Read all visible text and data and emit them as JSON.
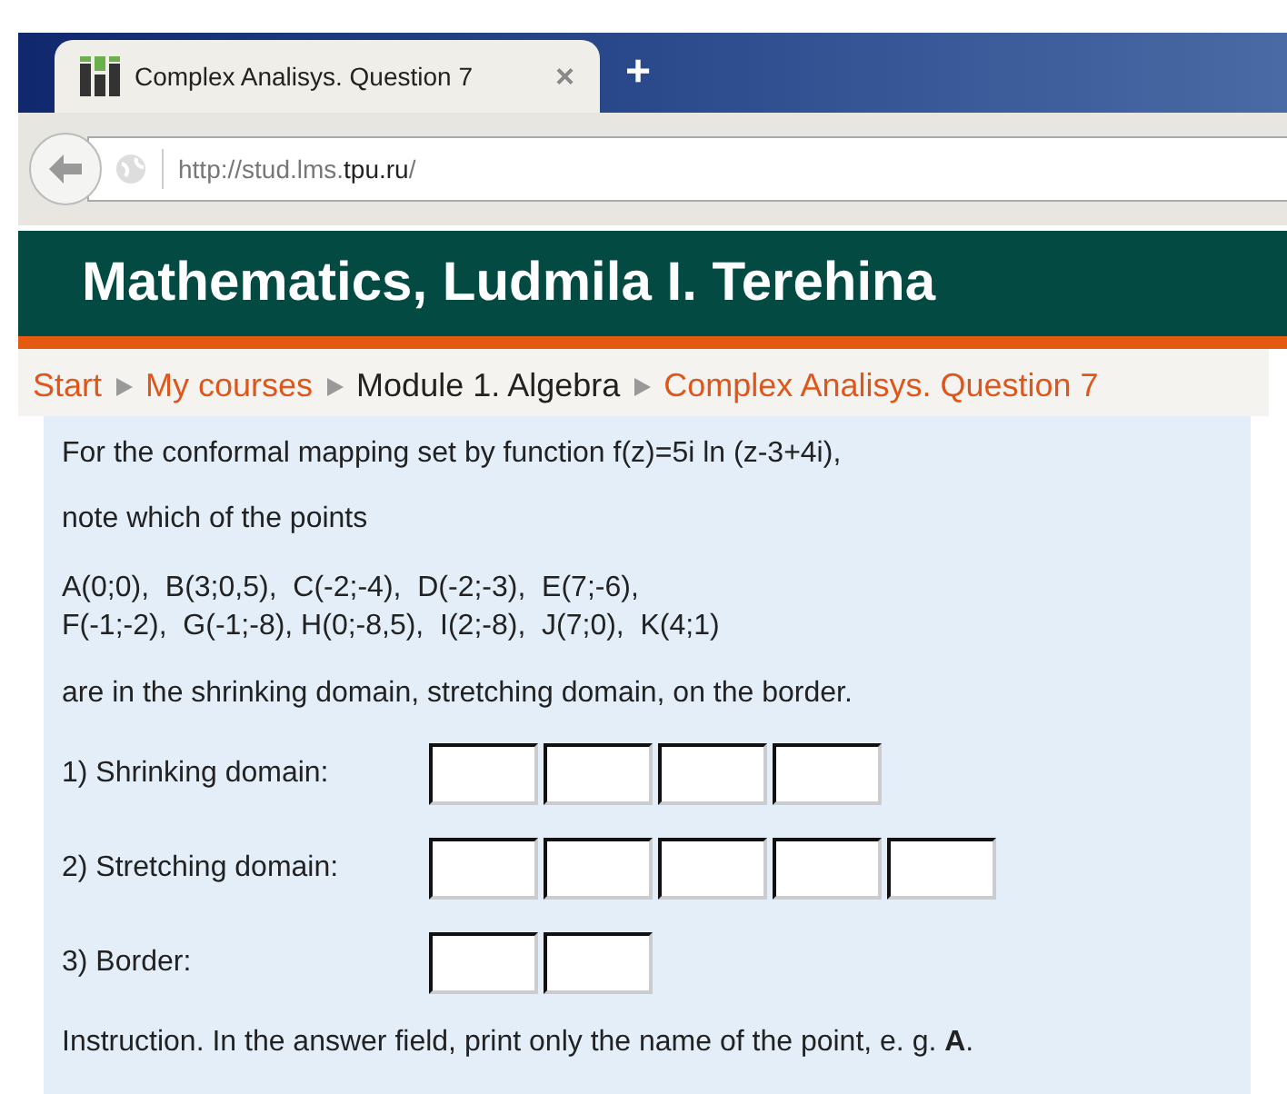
{
  "browser": {
    "tab_title": "Complex Analisys. Question 7",
    "tab_close": "×",
    "new_tab": "+",
    "url_prefix": "http://stud.lms.",
    "url_domain": "tpu.ru",
    "url_suffix": "/"
  },
  "header": {
    "title": "Mathematics, Ludmila I. Terehina"
  },
  "breadcrumb": [
    {
      "label": "Start",
      "kind": "link"
    },
    {
      "label": "My courses",
      "kind": "link"
    },
    {
      "label": "Module 1. Algebra",
      "kind": "current"
    },
    {
      "label": "Complex Analisys. Question 7",
      "kind": "link"
    }
  ],
  "question": {
    "paragraphs": [
      "For the conformal mapping set by function f(z)=5i ln (z-3+4i),",
      "note which of the points"
    ],
    "points": [
      "A(0;0),  B(3;0,5),  C(-2;-4),  D(-2;-3),  E(7;-6),",
      "F(-1;-2),  G(-1;-8), H(0;-8,5),  I(2;-8),  J(7;0),  K(4;1)"
    ],
    "task": "are in the shrinking domain, stretching domain, on the border.",
    "answers": [
      {
        "label": "1) Shrinking domain:",
        "fields": [
          {
            "kind": "text"
          },
          {
            "kind": "text"
          },
          {
            "kind": "text"
          },
          {
            "kind": "text"
          }
        ]
      },
      {
        "label": "2) Stretching domain:",
        "fields": [
          {
            "kind": "text"
          },
          {
            "kind": "text"
          },
          {
            "kind": "text"
          },
          {
            "kind": "text"
          },
          {
            "kind": "text"
          }
        ]
      },
      {
        "label": "3) Border:",
        "fields": [
          {
            "kind": "text"
          },
          {
            "kind": "text"
          }
        ]
      }
    ],
    "instruction": "Instruction. In the answer field, print only the name of the point, e. g. **A**."
  }
}
